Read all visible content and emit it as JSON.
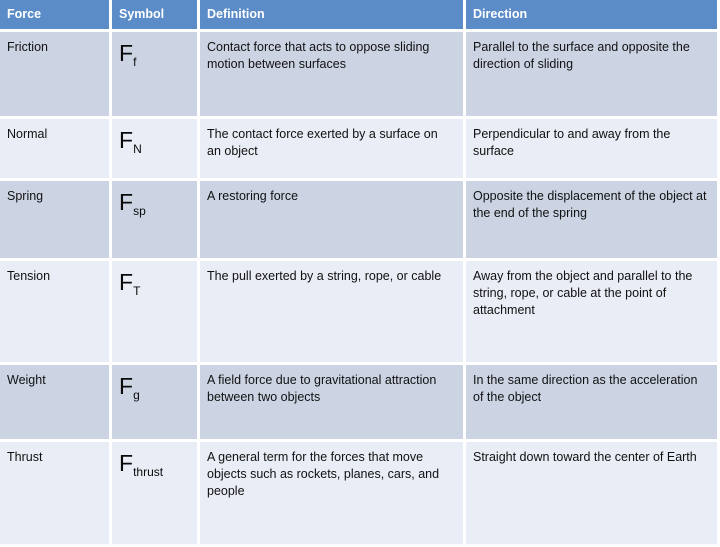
{
  "table": {
    "columns": [
      {
        "key": "force",
        "label": "Force"
      },
      {
        "key": "symbol",
        "label": "Symbol"
      },
      {
        "key": "definition",
        "label": "Definition"
      },
      {
        "key": "direction",
        "label": "Direction"
      }
    ],
    "header_bg": "#5b8cc8",
    "header_text_color": "#ffffff",
    "row_bg_dark": "#ccd4e4",
    "row_bg_light": "#e9edf5",
    "rows": [
      {
        "force": "Friction",
        "symbol_base": "F",
        "symbol_sub": "f",
        "symbol_text": "Ff",
        "definition": "Contact force that acts to oppose sliding motion between surfaces",
        "direction": "Parallel to the surface and opposite the direction of sliding"
      },
      {
        "force": "Normal",
        "symbol_base": "F",
        "symbol_sub": "N",
        "symbol_text": "FN",
        "definition": "The contact force exerted by a surface on an object",
        "direction": "Perpendicular to and away from the surface"
      },
      {
        "force": "Spring",
        "symbol_base": "F",
        "symbol_sub": "sp",
        "symbol_text": "Fsp",
        "definition": "A restoring force",
        "direction": "Opposite the displacement of the object at the end of the spring"
      },
      {
        "force": "Tension",
        "symbol_base": "F",
        "symbol_sub": "T",
        "symbol_text": "FT",
        "definition": "The pull exerted by a string, rope, or cable",
        "direction": "Away from the object and parallel to the string, rope, or cable at the point of attachment"
      },
      {
        "force": "Weight",
        "symbol_base": "F",
        "symbol_sub": "g",
        "symbol_text": "Fg",
        "definition": "A field force due to gravitational attraction between two objects",
        "direction": "In the same direction as the acceleration of the object"
      },
      {
        "force": "Thrust",
        "symbol_base": "F",
        "symbol_sub": "thrust",
        "symbol_text": "Fthrust",
        "definition": "A general term for the forces that move objects such as rockets, planes, cars, and people",
        "direction": "Straight down toward the center of Earth"
      }
    ]
  }
}
